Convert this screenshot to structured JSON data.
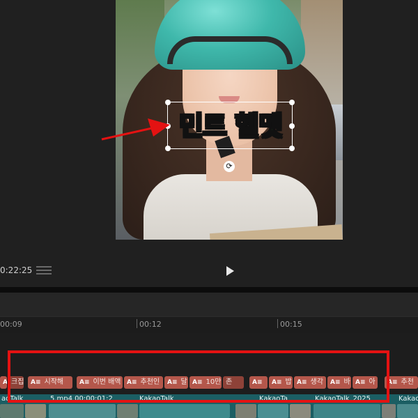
{
  "preview": {
    "caption_text": "민트 헬멧",
    "rotate_icon": "rotate-icon"
  },
  "transport": {
    "timecode": "0:22:25",
    "play_icon": "play-icon",
    "list_icon": "list-icon"
  },
  "ruler": {
    "ticks": [
      "00:09",
      "00:12",
      "00:15"
    ]
  },
  "subtitle_track": {
    "chips": [
      {
        "label": "",
        "icon": "A≡"
      },
      {
        "label": "크집",
        "icon": ""
      },
      {
        "label": "시작해",
        "icon": "A≡"
      },
      {
        "label": "이번 배액",
        "icon": "A≡"
      },
      {
        "label": "추천인",
        "icon": "A≡"
      },
      {
        "label": "달",
        "icon": "A≡"
      },
      {
        "label": "10만",
        "icon": "A≡"
      },
      {
        "label": "존",
        "icon": ""
      },
      {
        "label": "",
        "icon": "A≡"
      },
      {
        "label": "밥",
        "icon": "A≡"
      },
      {
        "label": "생각",
        "icon": "A≡"
      },
      {
        "label": "바",
        "icon": "A≡"
      },
      {
        "label": "아",
        "icon": "A≡"
      },
      {
        "label": "추천",
        "icon": "A≡"
      }
    ]
  },
  "video_track": {
    "clips": [
      "aoTalk",
      "5.mp4  00:00:01:2",
      "KakaoTalk",
      "KakaoTa",
      "KakaoTalk_2025",
      "Kakao"
    ]
  },
  "colors": {
    "caption_fill": "#35f02a",
    "highlight": "#e41212",
    "arrow": "#e41212",
    "chip": "#b4574b",
    "video_track": "#1b5e63"
  }
}
